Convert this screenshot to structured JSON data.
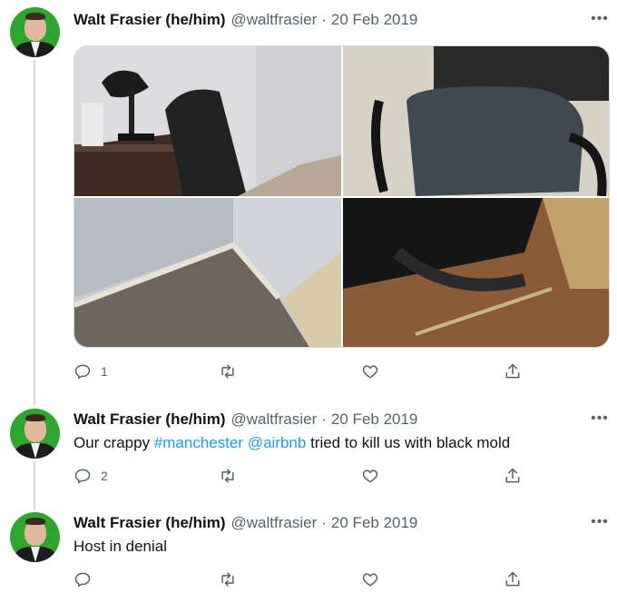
{
  "tweets": [
    {
      "name": "Walt Frasier (he/him)",
      "handle": "@waltfrasier",
      "separator": "·",
      "date": "20 Feb 2019",
      "reply_count": "1"
    },
    {
      "name": "Walt Frasier (he/him)",
      "handle": "@waltfrasier",
      "separator": "·",
      "date": "20 Feb 2019",
      "text_parts": [
        "Our crappy ",
        "#manchester",
        " ",
        "@airbnb",
        " tried to kill us with black mold"
      ],
      "reply_count": "2"
    },
    {
      "name": "Walt Frasier (he/him)",
      "handle": "@waltfrasier",
      "separator": "·",
      "date": "20 Feb 2019",
      "text": "Host in denial",
      "reply_count": ""
    }
  ],
  "icons": {
    "more": "more-options-icon",
    "reply": "reply-icon",
    "retweet": "retweet-icon",
    "like": "like-icon",
    "share": "share-icon"
  },
  "colors": {
    "link": "#1d9bf0",
    "muted": "#536471",
    "thread_line": "#cfd9de",
    "avatar_bg": "#2fa52f"
  },
  "more_glyph": "•••"
}
